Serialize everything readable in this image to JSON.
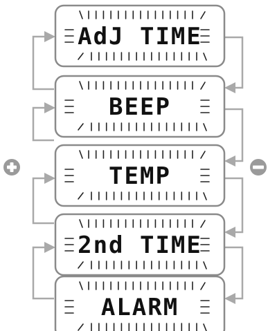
{
  "screens": [
    {
      "label": "AdJ TIME"
    },
    {
      "label": "BEEP"
    },
    {
      "label": "TEMP"
    },
    {
      "label": "2nd TIME"
    },
    {
      "label": "ALARM"
    }
  ],
  "buttons": {
    "plus": {
      "glyph": "+",
      "icon": "plus-circle-icon"
    },
    "minus": {
      "glyph": "−",
      "icon": "minus-circle-icon"
    }
  },
  "colors": {
    "frame": "#8a8a8a",
    "segment": "#222222",
    "flow": "#a9a9a9",
    "button": "#9a9a9a"
  }
}
